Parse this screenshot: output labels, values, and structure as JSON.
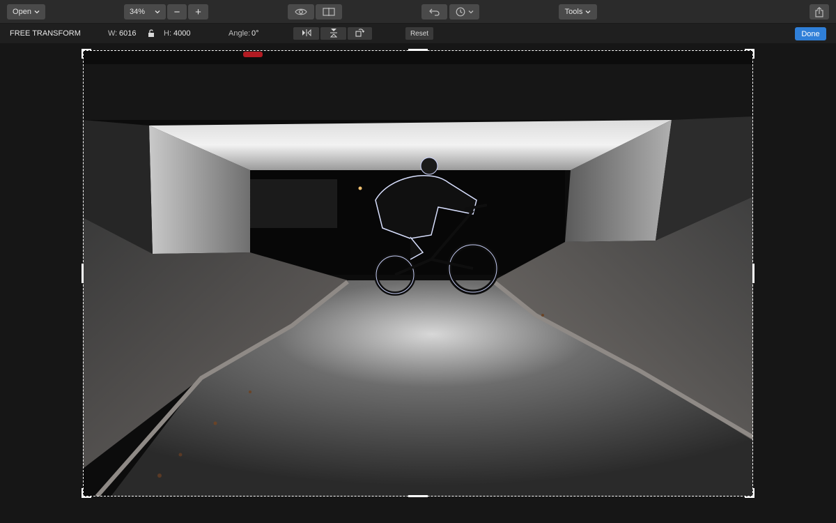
{
  "toolbar": {
    "open_label": "Open",
    "zoom_value": "34%",
    "zoom_out_label": "−",
    "zoom_in_label": "+",
    "tools_label": "Tools"
  },
  "transform_bar": {
    "mode_label": "FREE TRANSFORM",
    "width_label": "W:",
    "width_value": "6016",
    "height_label": "H:",
    "height_value": "4000",
    "angle_label": "Angle:",
    "angle_value": "0°",
    "reset_label": "Reset",
    "done_label": "Done"
  },
  "colors": {
    "accent": "#2f7fd8",
    "toolbar_bg": "#2b2b2b",
    "canvas_bg": "#161616"
  },
  "icons": [
    "chevron-down-icon",
    "eye-icon",
    "compare-icon",
    "undo-icon",
    "history-clock-icon",
    "lock-icon",
    "flip-horizontal-icon",
    "flip-vertical-icon",
    "rotate-icon",
    "share-icon"
  ]
}
